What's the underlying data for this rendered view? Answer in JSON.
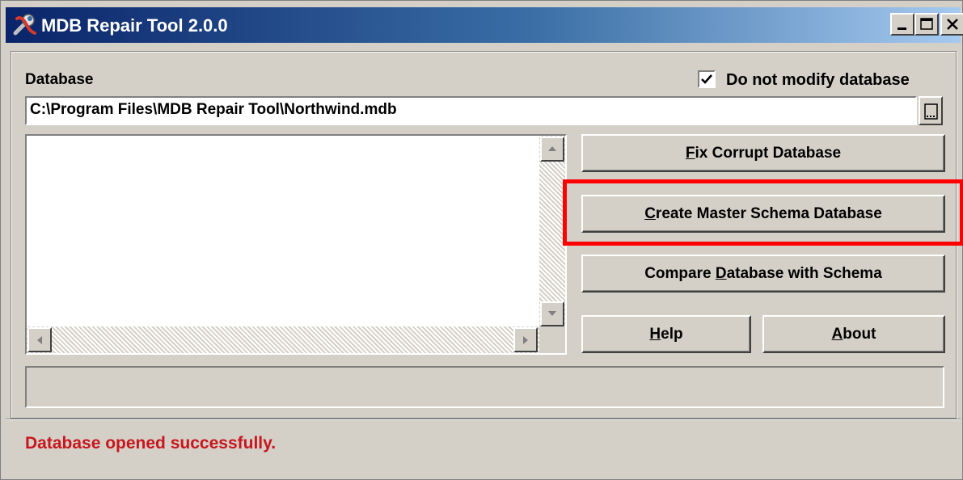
{
  "window": {
    "title": "MDB Repair Tool 2.0.0",
    "icon": "wrench-icon"
  },
  "database": {
    "label": "Database",
    "path": "C:\\Program Files\\MDB Repair Tool\\Northwind.mdb",
    "browse_icon": "browse-icon"
  },
  "options": {
    "do_not_modify_label": "Do not modify database",
    "do_not_modify_checked": true
  },
  "buttons": {
    "fix": {
      "mnemonic": "F",
      "rest": "ix Corrupt Database"
    },
    "create": {
      "mnemonic": "C",
      "rest": "reate Master Schema Database"
    },
    "compare": {
      "pre": "Compare ",
      "mnemonic": "D",
      "rest": "atabase with Schema"
    },
    "help": {
      "mnemonic": "H",
      "rest": "elp"
    },
    "about": {
      "mnemonic": "A",
      "rest": "bout"
    }
  },
  "status": {
    "message": "Database opened successfully.",
    "color": "#c8161d"
  },
  "highlight": {
    "target": "create-master-schema-button",
    "color": "#ff0000"
  },
  "colors": {
    "face": "#d4d0c8",
    "title_start": "#0a246a",
    "title_end": "#a6caf0"
  }
}
